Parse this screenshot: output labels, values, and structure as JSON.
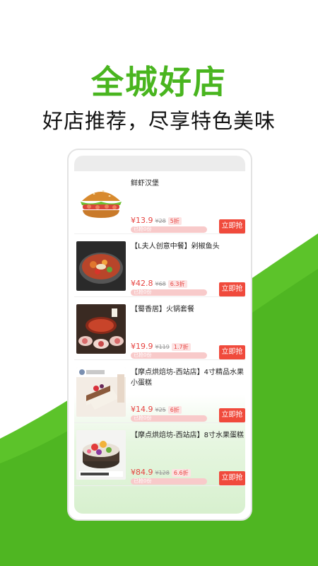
{
  "hero": {
    "title": "全城好店",
    "subtitle": "好店推荐，尽享特色美味"
  },
  "colors": {
    "brand_green": "#49b51f",
    "price_red": "#e64340",
    "button_red": "#f04a3c"
  },
  "deals": [
    {
      "name": "鲜虾汉堡",
      "price": "¥13.9",
      "original": "¥28",
      "discount": "5折",
      "sold": "已抢0份",
      "button": "立即抢",
      "image": "burger-image"
    },
    {
      "name": "【L夫人创意中餐】剁椒鱼头",
      "price": "¥42.8",
      "original": "¥68",
      "discount": "6.3折",
      "sold": "已抢0份",
      "button": "立即抢",
      "image": "hotpot-fish-image"
    },
    {
      "name": "【蜀香居】火锅套餐",
      "price": "¥19.9",
      "original": "¥119",
      "discount": "1.7折",
      "sold": "已抢0份",
      "button": "立即抢",
      "image": "hotpot-set-image"
    },
    {
      "name": "【摩点烘焙坊-西站店】4寸精品水果小蛋糕",
      "price": "¥14.9",
      "original": "¥25",
      "discount": "6折",
      "sold": "已抢0份",
      "button": "立即抢",
      "image": "small-cake-image"
    },
    {
      "name": "【摩点烘焙坊-西站店】8寸水果蛋糕",
      "price": "¥84.9",
      "original": "¥128",
      "discount": "6.6折",
      "sold": "已抢0份",
      "button": "立即抢",
      "image": "fruit-cake-image"
    }
  ]
}
